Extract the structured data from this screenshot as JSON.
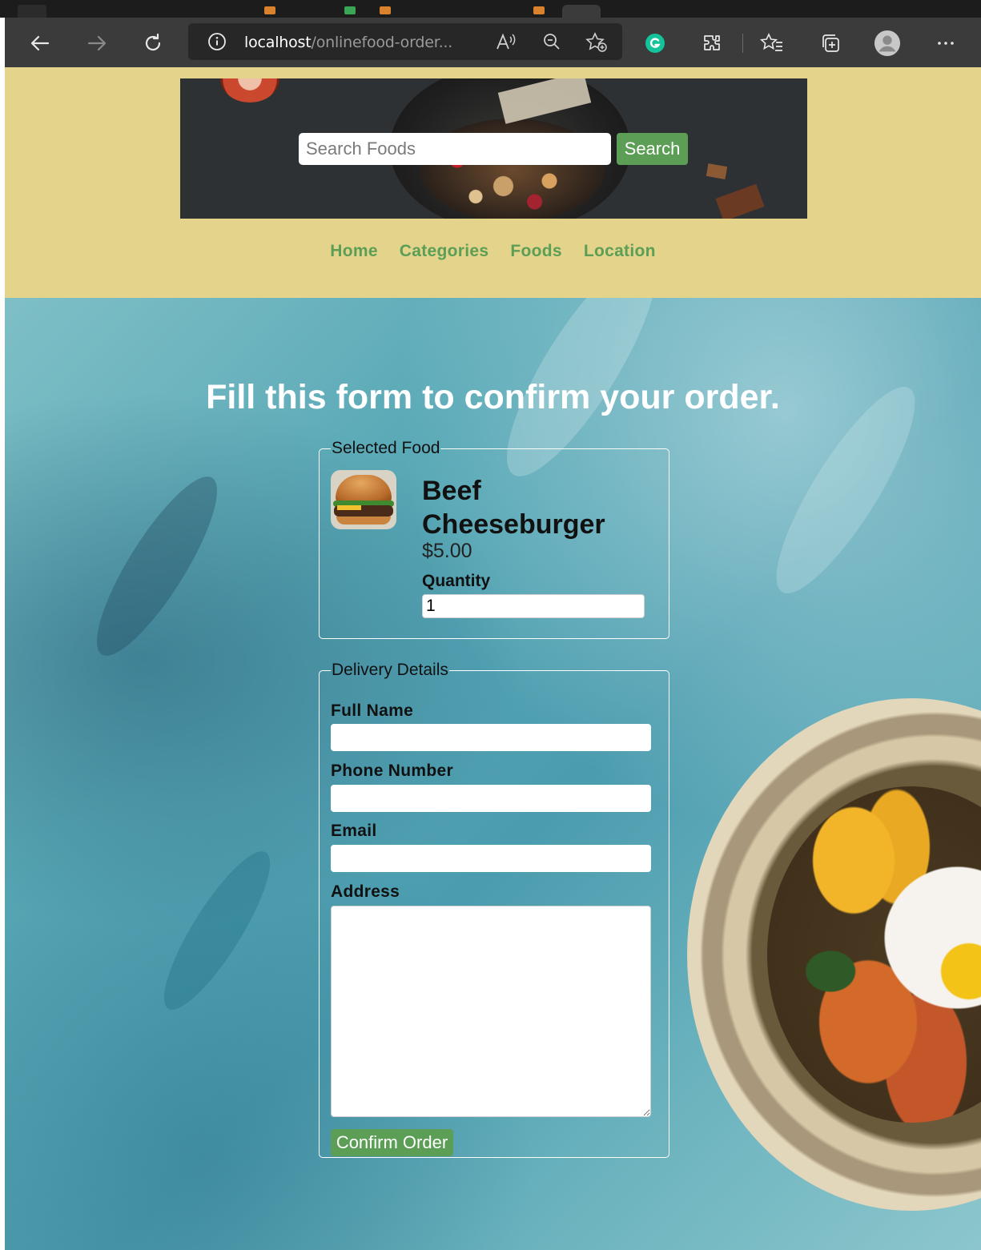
{
  "browser": {
    "url_host": "localhost",
    "url_path": "/onlinefood-order...",
    "icons": {
      "back": "arrow-left-icon",
      "forward": "arrow-right-icon",
      "refresh": "refresh-icon",
      "site_info": "info-icon",
      "read_aloud": "read-aloud-icon",
      "zoom": "zoom-out-icon",
      "add_favorite": "add-favorite-icon",
      "grammarly": "grammarly-icon",
      "extensions": "extensions-icon",
      "favorites": "favorites-icon",
      "collections": "collections-icon",
      "profile": "profile-icon",
      "more": "more-icon"
    }
  },
  "header": {
    "search": {
      "placeholder": "Search Foods",
      "button_label": "Search"
    },
    "nav": [
      "Home",
      "Categories",
      "Foods",
      "Location"
    ]
  },
  "order": {
    "title": "Fill this form to confirm your order.",
    "selected_food": {
      "legend": "Selected Food",
      "name": "Beef Cheeseburger",
      "price": "$5.00",
      "quantity_label": "Quantity",
      "quantity_value": "1"
    },
    "delivery": {
      "legend": "Delivery Details",
      "full_name_label": "Full Name",
      "phone_label": "Phone Number",
      "email_label": "Email",
      "address_label": "Address",
      "confirm_label": "Confirm Order"
    }
  },
  "colors": {
    "header_bg": "#e3d38b",
    "accent_green": "#5c9e56",
    "browser_toolbar": "#3b3b3b",
    "title_text": "#ffffff"
  }
}
